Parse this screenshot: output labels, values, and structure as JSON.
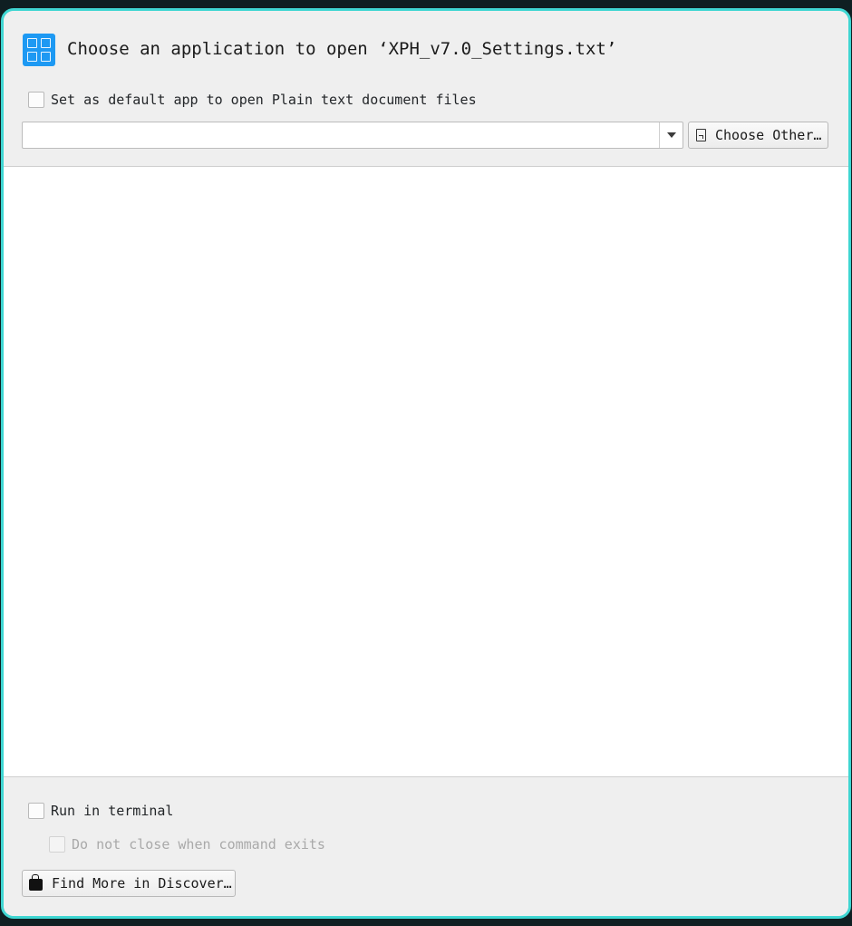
{
  "dialog": {
    "title": "Choose an application to open ‘XPH_v7.0_Settings.txt’",
    "app_icon": "grid-icon",
    "accent_color": "#1d99f3",
    "border_color": "#3fd6d2"
  },
  "default_option": {
    "label": "Set as default app to open Plain text document files",
    "checked": false
  },
  "command": {
    "value": "",
    "dropdown_icon": "chevron-down-icon"
  },
  "choose_other": {
    "label": "Choose Other…",
    "icon": "document-icon"
  },
  "app_list": {
    "items": []
  },
  "terminal": {
    "run_label": "Run in terminal",
    "run_checked": false,
    "no_close_label": "Do not close when command exits",
    "no_close_checked": false,
    "no_close_enabled": false
  },
  "discover": {
    "label": "Find More in Discover…",
    "icon": "shopping-bag-icon"
  }
}
